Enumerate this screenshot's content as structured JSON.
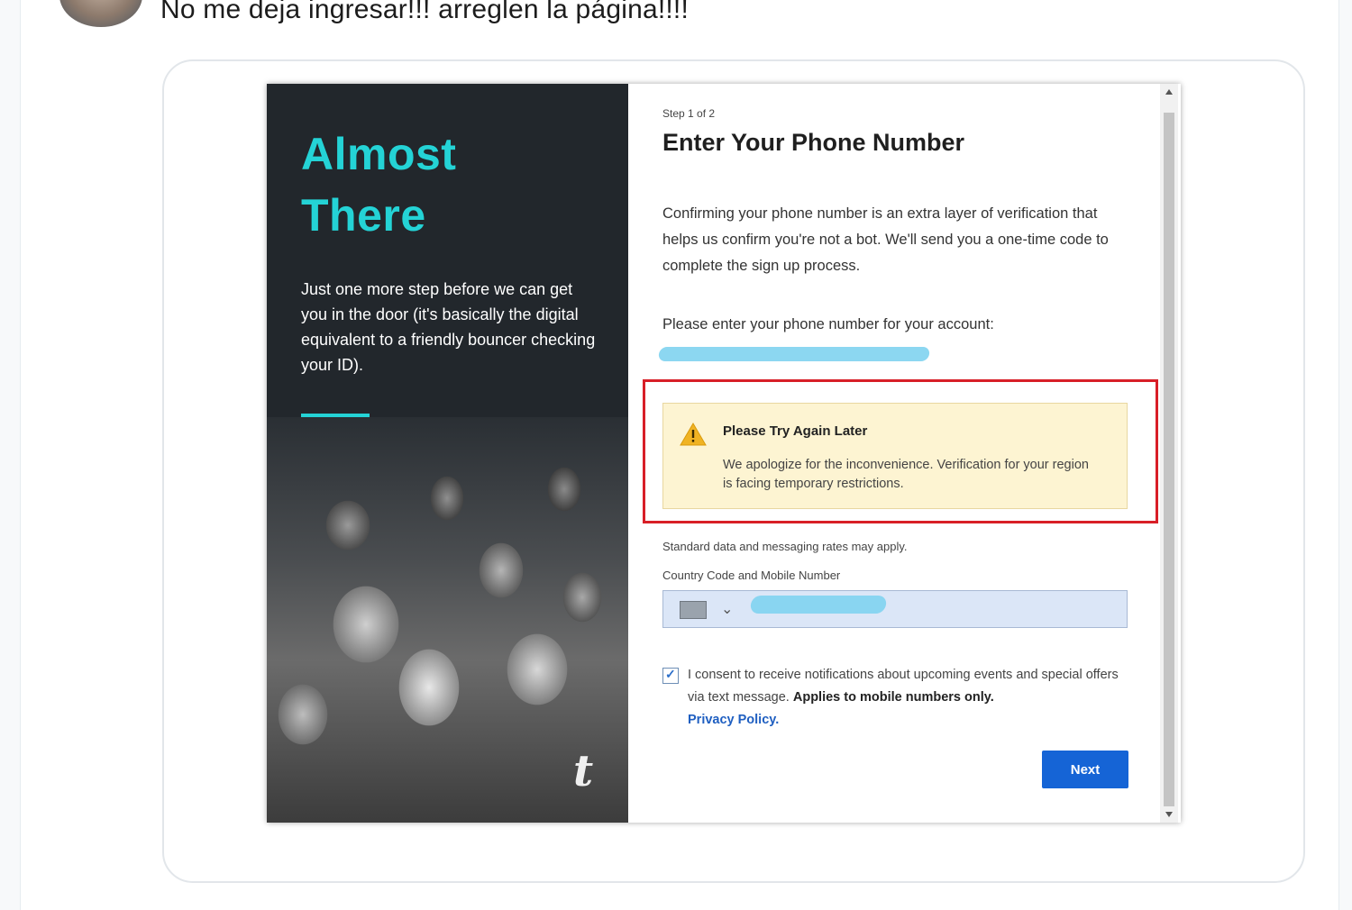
{
  "tweet": {
    "text": "No me deja ingresar!!! arreglen la página!!!!"
  },
  "left_panel": {
    "heading_line1": "Almost",
    "heading_line2": "There",
    "description": "Just one more step before we can get you in the door (it's basically the digital equivalent to a friendly bouncer checking your ID).",
    "logo": "t",
    "accent_color": "#24d3d6"
  },
  "form": {
    "step": "Step 1 of 2",
    "title": "Enter Your Phone Number",
    "intro": "Confirming your phone number is an extra layer of verification that helps us confirm you're not a bot. We'll send you a one-time code to complete the sign up process.",
    "prompt": "Please enter your phone number for your account:",
    "alert": {
      "icon": "warning-icon",
      "title": "Please Try Again Later",
      "body": "We apologize for the inconvenience. Verification for your region is facing temporary restrictions.",
      "highlight_color": "#d81f27"
    },
    "rates_note": "Standard data and messaging rates may apply.",
    "phone_label": "Country Code and Mobile Number",
    "consent_text": "I consent to receive notifications about upcoming events and special offers via text message. ",
    "consent_bold": "Applies to mobile numbers only.",
    "privacy_link": "Privacy Policy.",
    "consent_checked": true,
    "next_label": "Next",
    "button_color": "#1564d6"
  }
}
